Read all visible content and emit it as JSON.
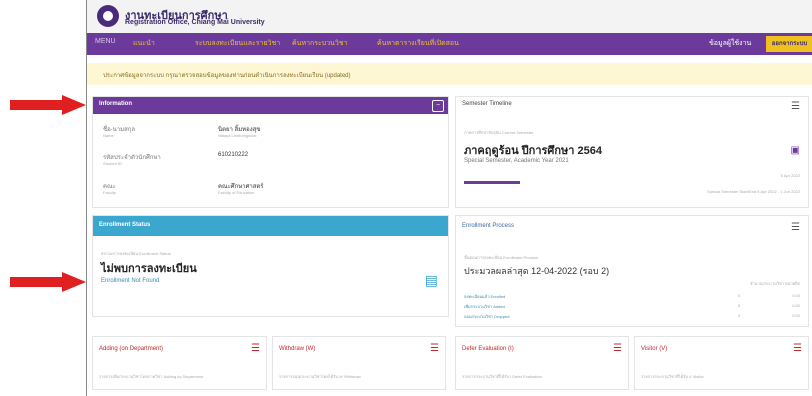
{
  "header": {
    "title": "งานทะเบียนการศึกษา",
    "subtitle": "Registration Office, Chiang Mai University"
  },
  "nav": {
    "menu_label": "MENU",
    "items": [
      "แนะนำ",
      "ระบบลงทะเบียนและรายวิชา",
      "ค้นหากระบวนวิชา",
      "ค้นหาตารางเรียนที่เปิดสอน"
    ],
    "user_label": "ข้อมูลผู้ใช้งาน",
    "logout_label": "ออกจากระบบ"
  },
  "notice": {
    "text": "ประกาศข้อมูลจากระบบ กรุณาตรวจสอบข้อมูลของท่านก่อนดำเนินการลงทะเบียนเรียน (updated)"
  },
  "information": {
    "title": "Information",
    "rows": [
      {
        "label": "ชื่อ-นามสกุล",
        "sublabel": "Name",
        "value": "นิตยา ลิ้มทองสุข",
        "subvalue": "Nittaya Limthongsook"
      },
      {
        "label": "รหัสประจำตัวนักศึกษา",
        "sublabel": "Student ID",
        "value": "610210222",
        "subvalue": ""
      },
      {
        "label": "คณะ",
        "sublabel": "Faculty",
        "value": "คณะศึกษาศาสตร์",
        "subvalue": "Faculty of Education"
      }
    ]
  },
  "semester": {
    "title": "Semester Timeline",
    "small_label": "ภาคการศึกษาปัจจุบัน Current Semester",
    "name": "ภาคฤดูร้อน ปีการศึกษา 2564",
    "name_en": "Special Semester, Academic Year 2021",
    "date_right": "5 Apr 2022",
    "range": "Special Semester Start/End 5 Apr 2022 - 1 Jun 2022"
  },
  "enrollment_status": {
    "title": "Enrollment Status",
    "small_label": "สถานะการลงทะเบียน Enrollment Status",
    "status": "ไม่พบการลงทะเบียน",
    "status_en": "Enrollment Not Found"
  },
  "enrollment_process": {
    "title": "Enrollment Process",
    "small_label": "ขั้นตอนการลงทะเบียน Enrollment Process",
    "announce": "ประมวลผลล่าสุด 12-04-2022 (รอบ 2)",
    "col_header": "จำนวนกระบวนวิชา  หน่วยกิต",
    "rows": [
      {
        "label": "ลงทะเบียนแล้ว Enrolled",
        "v1": "0",
        "v2": "0.00"
      },
      {
        "label": "เพิ่มกระบวนวิชา Added",
        "v1": "0",
        "v2": "0.00"
      },
      {
        "label": "ถอนกระบวนวิชา Dropped",
        "v1": "0",
        "v2": "0.00"
      }
    ]
  },
  "bottom_panels": [
    {
      "title": "Adding (on Department)",
      "desc": "รายการเพิ่มกระบวนวิชาโดยภาควิชา Adding by Department"
    },
    {
      "title": "Withdraw (W)",
      "desc": "รายการถอนกระบวนวิชาโดยได้รับ W Withdraw"
    },
    {
      "title": "Defer Evaluation (I)",
      "desc": "รายการกระบวนวิชาที่ได้รับ I Defer Evaluation"
    },
    {
      "title": "Visitor (V)",
      "desc": "รายการกระบวนวิชาที่ได้รับ V Visitor"
    }
  ],
  "colors": {
    "purple": "#6b3a9a",
    "yellow": "#f0c020",
    "blue": "#3ba7cf",
    "arrow_red": "#e02020"
  }
}
